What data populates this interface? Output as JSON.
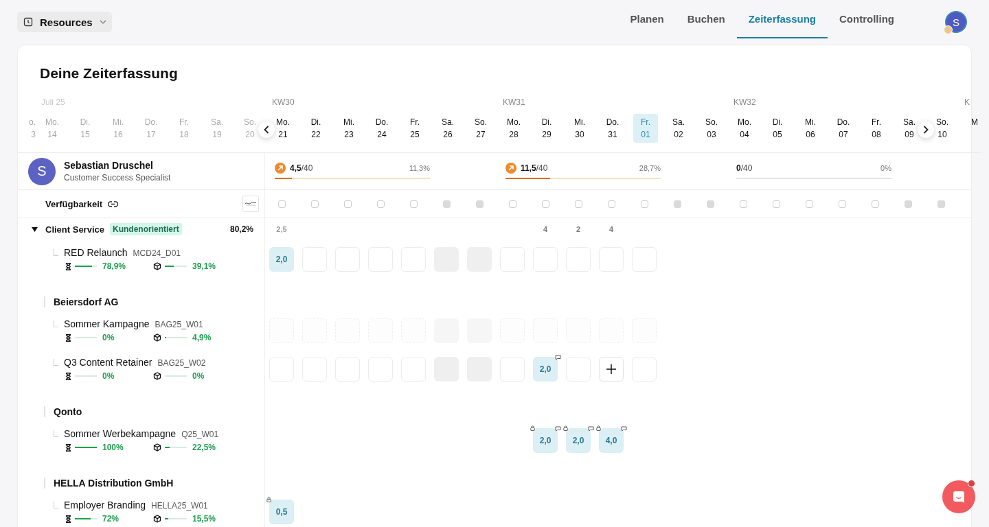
{
  "resources_button": {
    "label": "Resources"
  },
  "tabs": [
    {
      "label": "Planen",
      "selected": false
    },
    {
      "label": "Buchen",
      "selected": false
    },
    {
      "label": "Zeiterfassung",
      "selected": true
    },
    {
      "label": "Controlling",
      "selected": false
    }
  ],
  "user_avatar": {
    "initial": "S"
  },
  "title": "Deine Zeiterfassung",
  "days": [
    {
      "weekday": "o.",
      "date": "3",
      "past": true,
      "selected": false
    },
    {
      "label": "Juli 25",
      "weekday": "Mo.",
      "date": "14",
      "past": true,
      "selected": false
    },
    {
      "weekday": "Di.",
      "date": "15",
      "past": true,
      "selected": false
    },
    {
      "weekday": "Mi.",
      "date": "16",
      "past": true,
      "selected": false
    },
    {
      "weekday": "Do.",
      "date": "17",
      "past": true,
      "selected": false
    },
    {
      "weekday": "Fr.",
      "date": "18",
      "past": true,
      "selected": false
    },
    {
      "weekday": "Sa.",
      "date": "19",
      "past": true,
      "selected": false
    },
    {
      "weekday": "So.",
      "date": "20",
      "past": true,
      "selected": false
    },
    {
      "label": "KW30",
      "weekday": "Mo.",
      "date": "21",
      "past": false,
      "weekend": false,
      "selected": false,
      "total": "2,5"
    },
    {
      "weekday": "Di.",
      "date": "22",
      "past": false,
      "weekend": false,
      "selected": false
    },
    {
      "weekday": "Mi.",
      "date": "23",
      "past": false,
      "weekend": false,
      "selected": false
    },
    {
      "weekday": "Do.",
      "date": "24",
      "past": false,
      "weekend": false,
      "selected": false
    },
    {
      "weekday": "Fr.",
      "date": "25",
      "past": false,
      "weekend": false,
      "selected": false
    },
    {
      "weekday": "Sa.",
      "date": "26",
      "past": false,
      "weekend": true,
      "selected": false
    },
    {
      "weekday": "So.",
      "date": "27",
      "past": false,
      "weekend": true,
      "selected": false
    },
    {
      "label": "KW31",
      "weekday": "Mo.",
      "date": "28",
      "past": false,
      "weekend": false,
      "selected": false
    },
    {
      "weekday": "Di.",
      "date": "29",
      "past": false,
      "weekend": false,
      "selected": false,
      "total": "4"
    },
    {
      "weekday": "Mi.",
      "date": "30",
      "past": false,
      "weekend": false,
      "selected": false,
      "total": "2"
    },
    {
      "weekday": "Do.",
      "date": "31",
      "past": false,
      "weekend": false,
      "selected": false,
      "total": "4"
    },
    {
      "weekday": "Fr.",
      "date": "01",
      "past": false,
      "weekend": false,
      "selected": true
    },
    {
      "weekday": "Sa.",
      "date": "02",
      "past": false,
      "weekend": true,
      "selected": false
    },
    {
      "weekday": "So.",
      "date": "03",
      "past": false,
      "weekend": true,
      "selected": false
    },
    {
      "label": "KW32",
      "weekday": "Mo.",
      "date": "04",
      "past": false,
      "weekend": false,
      "selected": false
    },
    {
      "weekday": "Di.",
      "date": "05",
      "past": false,
      "weekend": false,
      "selected": false
    },
    {
      "weekday": "Mi.",
      "date": "06",
      "past": false,
      "weekend": false,
      "selected": false
    },
    {
      "weekday": "Do.",
      "date": "07",
      "past": false,
      "weekend": false,
      "selected": false
    },
    {
      "weekday": "Fr.",
      "date": "08",
      "past": false,
      "weekend": false,
      "selected": false
    },
    {
      "weekday": "Sa.",
      "date": "09",
      "past": false,
      "weekend": true,
      "selected": false
    },
    {
      "weekday": "So.",
      "date": "10",
      "past": false,
      "weekend": true,
      "selected": false
    },
    {
      "label": "K",
      "weekday": "M",
      "past": false,
      "selected": false
    }
  ],
  "person": {
    "initial": "S",
    "name": "Sebastian Druschel",
    "role": "Customer Success Specialist"
  },
  "weeks": [
    {
      "trend": true,
      "hours": "4,5",
      "capacity": "/40",
      "percent": "11,3%",
      "level": 0.1125
    },
    {
      "trend": true,
      "hours": "11,5",
      "capacity": "/40",
      "percent": "28,7%",
      "level": 0.2875
    },
    {
      "trend": false,
      "hours": "0",
      "capacity": "/40",
      "percent": "0%",
      "level": 0
    }
  ],
  "availability": {
    "label": "Verfügbarkeit"
  },
  "group": {
    "name": "Client Service",
    "tag": "Kundenorientiert",
    "percent": "80,2%",
    "expanded": true,
    "children": [
      {
        "kind": "project",
        "name": "RED Relaunch",
        "code": "MCD24_D01",
        "disabled": false,
        "time": {
          "level": 0.789,
          "text": "78,9%"
        },
        "budget": {
          "level": 0.391,
          "text": "39,1%"
        },
        "cells": [
          {
            "kind": "value",
            "value": "2,0"
          },
          {
            "kind": "empty"
          },
          {
            "kind": "empty"
          },
          {
            "kind": "empty"
          },
          {
            "kind": "empty"
          },
          {
            "kind": "weekend"
          },
          {
            "kind": "weekend"
          },
          {
            "kind": "empty"
          },
          {
            "kind": "empty"
          },
          {
            "kind": "empty"
          },
          {
            "kind": "empty"
          },
          {
            "kind": "empty"
          }
        ]
      },
      {
        "kind": "client",
        "name": "Beiersdorf AG",
        "children": [
          {
            "kind": "project",
            "name": "Sommer Kampagne",
            "code": "BAG25_W01",
            "disabled": true,
            "time": {
              "level": 0,
              "text": "0%"
            },
            "budget": {
              "level": 0.049,
              "text": "4,9%"
            },
            "cells": [
              {
                "kind": "empty"
              },
              {
                "kind": "empty"
              },
              {
                "kind": "empty"
              },
              {
                "kind": "empty"
              },
              {
                "kind": "empty"
              },
              {
                "kind": "weekend"
              },
              {
                "kind": "weekend"
              },
              {
                "kind": "empty"
              },
              {
                "kind": "empty"
              },
              {
                "kind": "empty"
              },
              {
                "kind": "empty"
              },
              {
                "kind": "empty"
              }
            ]
          },
          {
            "kind": "project",
            "name": "Q3 Content Retainer",
            "code": "BAG25_W02",
            "disabled": false,
            "time": {
              "level": 0,
              "text": "0%"
            },
            "budget": {
              "level": 0,
              "text": "0%"
            },
            "cells": [
              {
                "kind": "empty"
              },
              {
                "kind": "empty"
              },
              {
                "kind": "empty"
              },
              {
                "kind": "empty"
              },
              {
                "kind": "empty"
              },
              {
                "kind": "weekend"
              },
              {
                "kind": "weekend"
              },
              {
                "kind": "empty"
              },
              {
                "kind": "value",
                "value": "2,0",
                "comment": true
              },
              {
                "kind": "empty"
              },
              {
                "kind": "add"
              },
              {
                "kind": "empty"
              }
            ]
          }
        ]
      },
      {
        "kind": "client",
        "name": "Qonto",
        "children": [
          {
            "kind": "project",
            "name": "Sommer Werbekampagne",
            "code": "Q25_W01",
            "disabled": false,
            "time": {
              "level": 1,
              "text": "100%"
            },
            "budget": {
              "level": 0.225,
              "text": "22,5%"
            },
            "cells": [
              {
                "kind": "blank"
              },
              {
                "kind": "blank"
              },
              {
                "kind": "blank"
              },
              {
                "kind": "blank"
              },
              {
                "kind": "blank"
              },
              {
                "kind": "blank"
              },
              {
                "kind": "blank"
              },
              {
                "kind": "blank"
              },
              {
                "kind": "value",
                "value": "2,0",
                "locked": true,
                "comment": true
              },
              {
                "kind": "value",
                "value": "2,0",
                "locked": true,
                "comment": true
              },
              {
                "kind": "value",
                "value": "4,0",
                "locked": true,
                "comment": true
              }
            ]
          }
        ]
      },
      {
        "kind": "client",
        "name": "HELLA Distribution GmbH",
        "children": [
          {
            "kind": "project",
            "name": "Employer Branding",
            "code": "HELLA25_W01",
            "disabled": false,
            "time": {
              "level": 0.72,
              "text": "72%"
            },
            "budget": {
              "level": 0.155,
              "text": "15,5%"
            },
            "cells": [
              {
                "kind": "value",
                "value": "0,5",
                "locked": true
              }
            ]
          }
        ]
      }
    ]
  }
}
